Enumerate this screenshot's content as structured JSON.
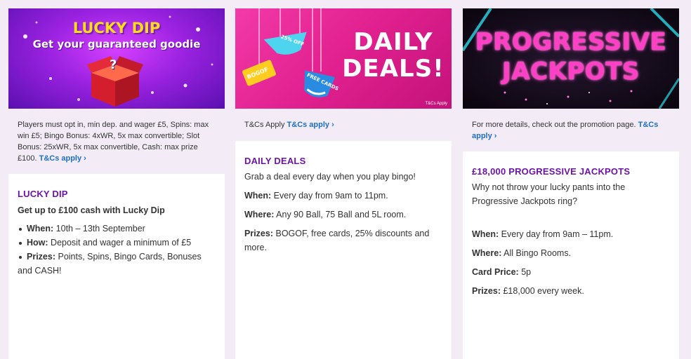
{
  "cards": [
    {
      "banner": {
        "title": "LUCKY DIP",
        "subtitle": "Get your guaranteed goodie",
        "box_mark": "?"
      },
      "terms": "Players must opt in, min dep. and wager £5, Spins: max win £5; Bingo Bonus: 4xWR, 5x max convertible; Slot Bonus: 25xWR, 5x max convertible, Cash: max prize £100.",
      "terms_link": "T&Cs apply",
      "title": "LUCKY DIP",
      "lead": "Get up to £100 cash with Lucky Dip",
      "bullets": [
        {
          "label": "When:",
          "text": "10th – 13th September"
        },
        {
          "label": "How:",
          "text": "Deposit and wager a minimum of £5"
        },
        {
          "label": "Prizes:",
          "text": "Points, Spins, Bingo Cards, Bonuses and CASH!"
        }
      ]
    },
    {
      "banner": {
        "title_line1": "DAILY",
        "title_line2": "DEALS!",
        "tag_discount": "25% OFF",
        "tag_bogof": "BOGOF",
        "tag_free": "FREE CARDS",
        "fine_print": "T&Cs Apply"
      },
      "terms": "T&Cs Apply",
      "terms_link": "T&Cs apply",
      "title": "DAILY DEALS",
      "lead": "Grab a deal every day when you play bingo!",
      "details": [
        {
          "label": "When:",
          "text": "Every day from 9am to 11pm."
        },
        {
          "label": "Where:",
          "text": "Any 90 Ball, 75 Ball and 5L room."
        },
        {
          "label": "Prizes:",
          "text": "BOGOF, free cards, 25% discounts and more."
        }
      ]
    },
    {
      "banner": {
        "title_line1": "PROGRESSIVE",
        "title_line2": "JACKPOTS"
      },
      "terms": "For more details, check out the promotion page.",
      "terms_link": "T&Cs apply",
      "title": "£18,000 PROGRESSIVE JACKPOTS",
      "lead": "Why not throw your lucky pants into the Progressive Jackpots ring?",
      "details": [
        {
          "label": "When:",
          "text": "Every day from 9am – 11pm."
        },
        {
          "label": "Where:",
          "text": "All Bingo Rooms."
        },
        {
          "label": "Card Price:",
          "text": "5p"
        },
        {
          "label": "Prizes:",
          "text": "£18,000 every week."
        }
      ]
    }
  ],
  "colors": {
    "accent_purple": "#6d14a8",
    "link_blue": "#1c6fc7",
    "page_bg": "#f3ecf7"
  }
}
